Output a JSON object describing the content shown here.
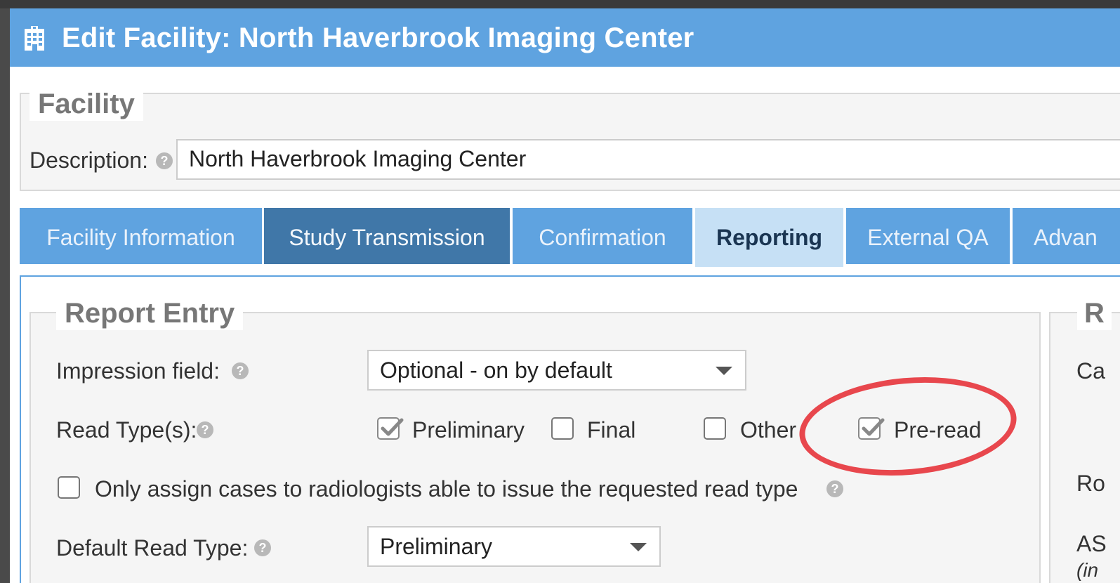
{
  "dialog": {
    "title": "Edit Facility: North Haverbrook Imaging Center"
  },
  "facility": {
    "legend": "Facility",
    "description_label": "Description:",
    "description_value": "North Haverbrook Imaging Center"
  },
  "tabs": [
    {
      "label": "Facility Information",
      "state": "normal"
    },
    {
      "label": "Study Transmission",
      "state": "hover"
    },
    {
      "label": "Confirmation",
      "state": "normal"
    },
    {
      "label": "Reporting",
      "state": "active"
    },
    {
      "label": "External QA",
      "state": "normal"
    },
    {
      "label": "Advan",
      "state": "normal"
    }
  ],
  "report_entry": {
    "legend": "Report Entry",
    "impression_label": "Impression field:",
    "impression_value": "Optional - on by default",
    "read_types_label": "Read Type(s):",
    "read_types": [
      {
        "label": "Preliminary",
        "checked": true
      },
      {
        "label": "Final",
        "checked": false
      },
      {
        "label": "Other",
        "checked": false
      },
      {
        "label": "Pre-read",
        "checked": true
      }
    ],
    "only_assign_label": "Only assign cases to radiologists able to issue the requested read type",
    "only_assign_checked": false,
    "default_read_label": "Default Read Type:",
    "default_read_value": "Preliminary"
  },
  "right_panel": {
    "legend": "R",
    "lines": [
      "Ca",
      "Ro",
      "AS",
      "(in"
    ]
  },
  "annotation": {
    "color": "#e8474d"
  }
}
